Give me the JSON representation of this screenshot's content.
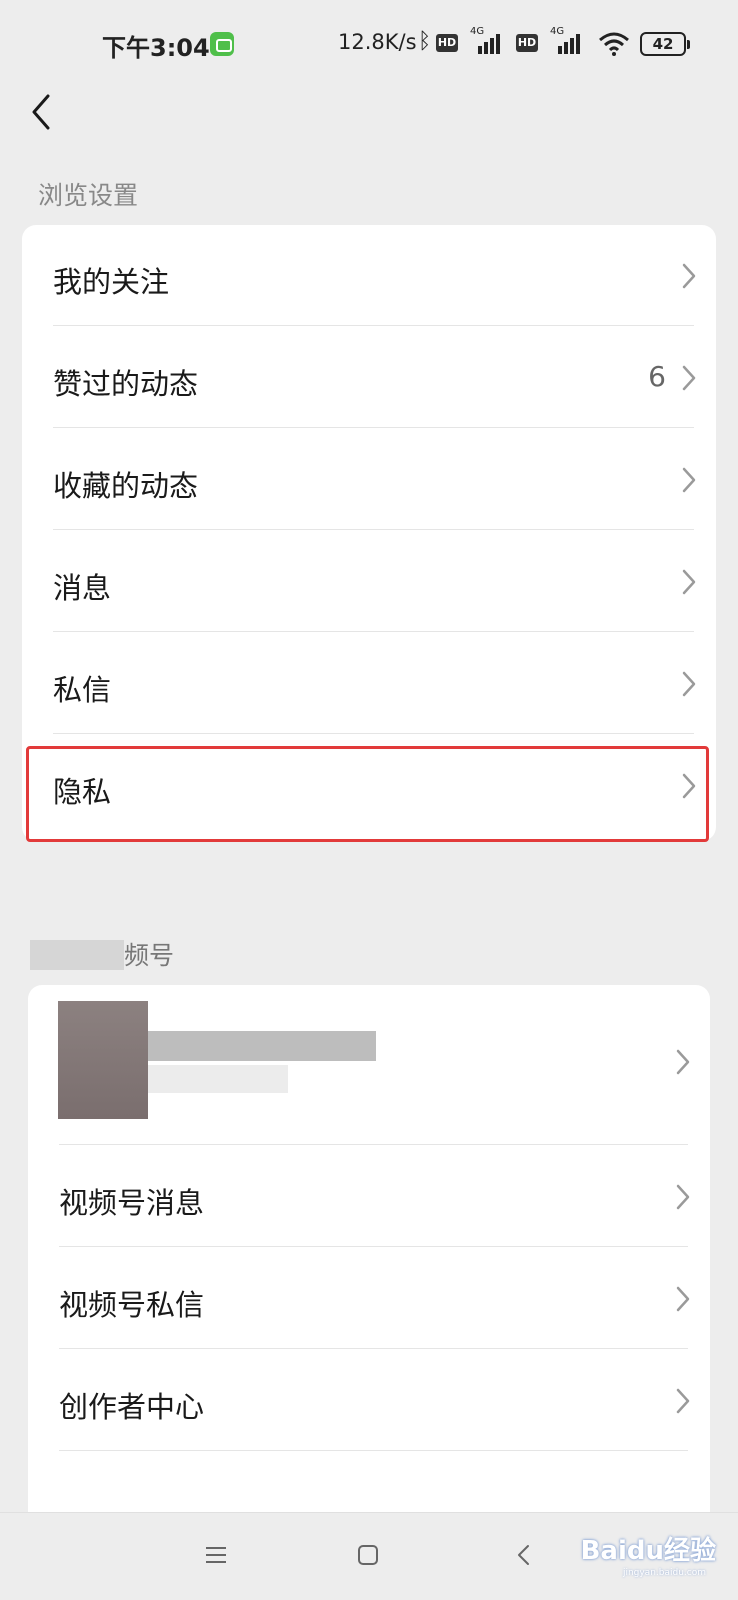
{
  "status_bar": {
    "time": "下午3:04",
    "speed": "12.8K/s",
    "hd_badge": "HD",
    "net_type": "4G",
    "battery": "42"
  },
  "icons": {
    "back": "chevron-left-icon",
    "row_arrow": "chevron-right-icon"
  },
  "colors": {
    "highlight": "#e23a3a",
    "background": "#ededed",
    "card": "#ffffff"
  },
  "browse_section": {
    "header": "浏览设置",
    "items": [
      {
        "label": "我的关注",
        "badge": ""
      },
      {
        "label": "赞过的动态",
        "badge": "6"
      },
      {
        "label": "收藏的动态",
        "badge": ""
      },
      {
        "label": "消息",
        "badge": ""
      },
      {
        "label": "私信",
        "badge": ""
      },
      {
        "label": "隐私",
        "badge": "",
        "highlighted": true
      }
    ]
  },
  "channels_section": {
    "header_partial": "频号",
    "items": [
      {
        "label": "视频号消息"
      },
      {
        "label": "视频号私信"
      },
      {
        "label": "创作者中心"
      }
    ]
  },
  "watermark": {
    "text": "Baidu经验",
    "sub": "jingyan.baidu.com"
  }
}
